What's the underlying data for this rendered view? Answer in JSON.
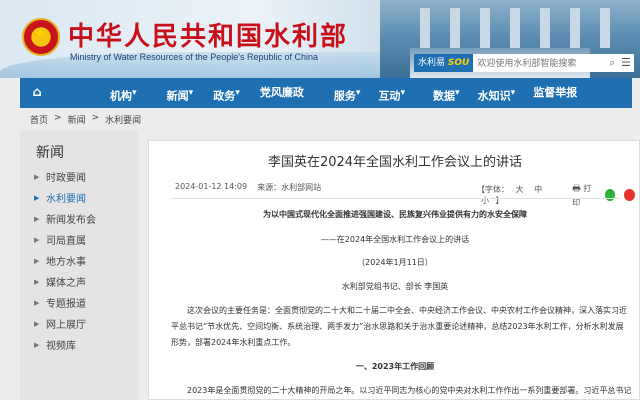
{
  "header": {
    "site_title": "中华人民共和国水利部",
    "site_subtitle": "Ministry of Water Resources of the People's Republic of China",
    "search_brand": "水利易",
    "search_brand_accent": "SOU",
    "search_placeholder": "欢迎使用水利部智能搜索"
  },
  "nav": {
    "items": [
      {
        "label": "机构"
      },
      {
        "label": "新闻"
      },
      {
        "label": "政务"
      },
      {
        "label": "党风廉政"
      },
      {
        "label": "服务"
      },
      {
        "label": "互动"
      },
      {
        "label": "数据"
      },
      {
        "label": "水知识"
      },
      {
        "label": "监督举报"
      }
    ]
  },
  "breadcrumb": [
    "首页",
    ">",
    "新闻",
    ">",
    "水利要闻"
  ],
  "sidebar": {
    "title": "新闻",
    "items": [
      {
        "label": "时政要闻"
      },
      {
        "label": "水利要闻"
      },
      {
        "label": "新闻发布会"
      },
      {
        "label": "司局直属"
      },
      {
        "label": "地方水事"
      },
      {
        "label": "媒体之声"
      },
      {
        "label": "专题报道"
      },
      {
        "label": "网上展厅"
      },
      {
        "label": "视频库"
      }
    ],
    "active_index": 1
  },
  "article": {
    "title": "李国英在2024年全国水利工作会议上的讲话",
    "date": "2024-01-12 14:09",
    "source": "来源：水利部网站",
    "font_label": "【字体：",
    "font_big": "大",
    "font_mid": "中",
    "font_small": "小",
    "font_close": "】",
    "print_label": "打印",
    "heading": "为以中国式现代化全面推进强国建设、民族复兴伟业提供有力的水安全保障",
    "subheading": "——在2024年全国水利工作会议上的讲话",
    "speech_date": "（2024年1月11日）",
    "speaker": "水利部党组书记、部长 李国英",
    "paragraph1": "这次会议的主要任务是：全面贯彻党的二十大和二十届二中全会、中央经济工作会议、中央农村工作会议精神，深入落实习近平总书记“节水优先、空间均衡、系统治理、两手发力”治水思路和关于治水重要论述精神，总结2023年水利工作，分析水利发展形势，部署2024年水利重点工作。",
    "section1": "一、2023年工作回顾",
    "paragraph2": "2023年是全面贯彻党的二十大精神的开局之年。以习近平同志为核心的党中央对水利工作作出一系列重要部署。习近平总书记多"
  }
}
